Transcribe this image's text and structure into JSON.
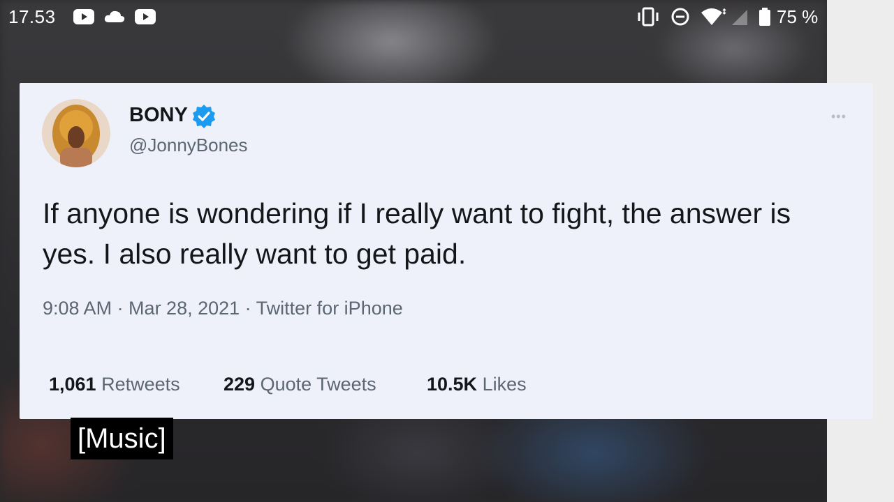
{
  "status_bar": {
    "time": "17.53",
    "left_icons": [
      "youtube-icon",
      "cloud-icon",
      "youtube-icon"
    ],
    "right_icons": [
      "vibrate-icon",
      "do-not-disturb-icon",
      "wifi-icon",
      "signal-icon",
      "battery-icon"
    ],
    "battery": "75 %"
  },
  "tweet": {
    "author_name": "BONY",
    "verified": true,
    "handle": "@JonnyBones",
    "text": "If anyone is wondering if I really want to fight, the answer is yes. I also really want to get paid.",
    "meta": "9:08 AM · Mar 28, 2021 · Twitter for iPhone",
    "stats": {
      "retweets_count": "1,061",
      "retweets_label": "Retweets",
      "quotes_count": "229",
      "quotes_label": "Quote Tweets",
      "likes_count": "10.5K",
      "likes_label": "Likes"
    }
  },
  "caption": "[Music]",
  "colors": {
    "verified_blue": "#1d9bf0",
    "card_bg": "#eff1fa",
    "nav_bar_bg": "#ededed"
  }
}
